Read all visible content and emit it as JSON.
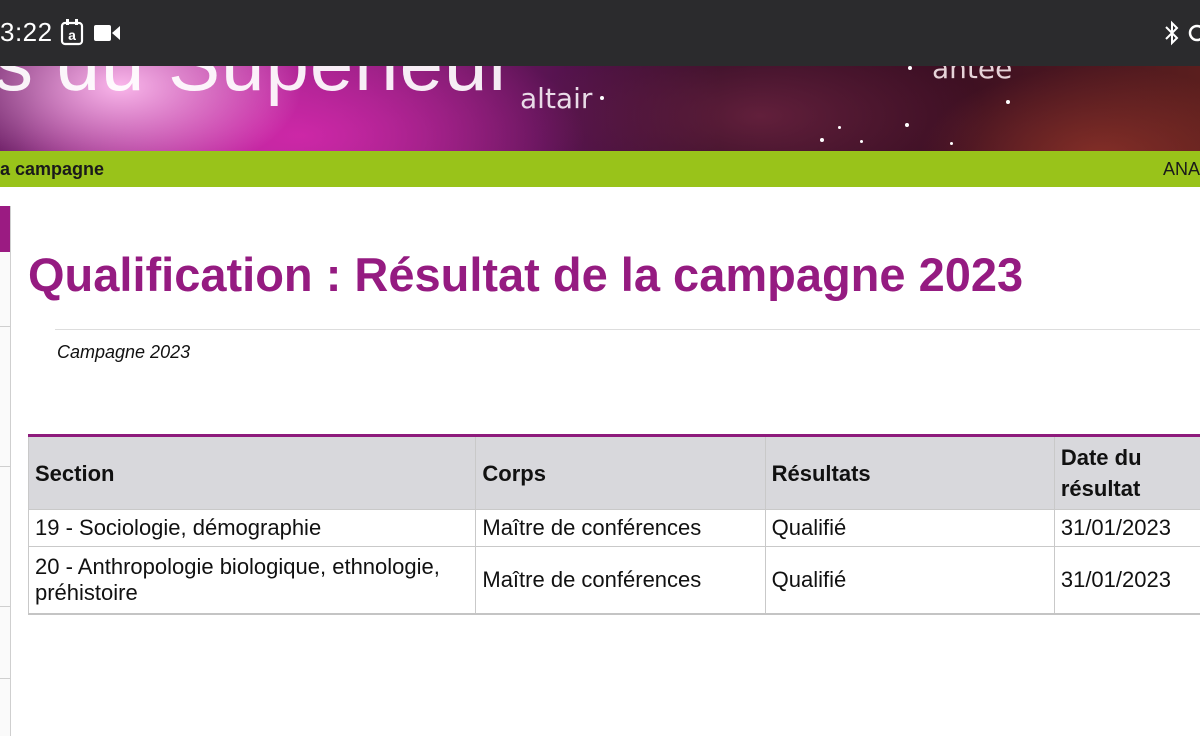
{
  "status_bar": {
    "time": "3:22",
    "left_icons": [
      "amazon-app-icon",
      "video-camera-icon"
    ],
    "right_icons": [
      "bluetooth-icon",
      "signal-icon"
    ]
  },
  "banner": {
    "title_partial": "s du Supérieur",
    "altair_text": "altair",
    "right_text_partial": "antée"
  },
  "nav": {
    "left_label": "a campagne",
    "right_label": "ANA"
  },
  "page": {
    "title": "Qualification : Résultat de la campagne 2023",
    "subtitle": "Campagne 2023"
  },
  "table": {
    "headers": [
      "Section",
      "Corps",
      "Résultats",
      "Date du résultat"
    ],
    "rows": [
      {
        "section": "19 - Sociologie, démographie",
        "corps": "Maître de conférences",
        "resultat": "Qualifié",
        "date": "31/01/2023"
      },
      {
        "section": "20 - Anthropologie biologique, ethnologie, préhistoire",
        "corps": "Maître de conférences",
        "resultat": "Qualifié",
        "date": "31/01/2023"
      }
    ]
  },
  "colors": {
    "accent_purple": "#951b81",
    "nav_green": "#99c31a",
    "status_bar": "#2b2b2d",
    "table_header": "#d8d8dc"
  }
}
